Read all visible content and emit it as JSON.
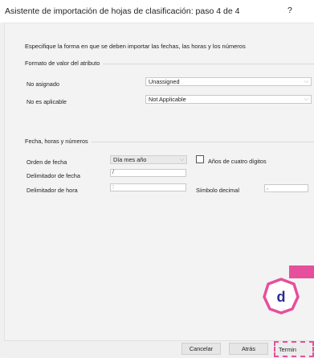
{
  "window": {
    "title": "Asistente de importación de hojas de clasificación: paso 4 de 4",
    "help": "?"
  },
  "instruction": "Especifique la forma en que se deben importar las fechas, las horas y los números",
  "attribute_format": {
    "section_title": "Formato de valor del atributo",
    "rows": [
      {
        "label": "No asignado",
        "value": "Unassigned"
      },
      {
        "label": "No es aplicable",
        "value": "Not Applicable"
      }
    ]
  },
  "datetime": {
    "section_title": "Fecha, horas y números",
    "date_order_label": "Orden de fecha",
    "date_order_value": "Día mes año",
    "four_digit_years_label": "Años de cuatro dígitos",
    "date_delimiter_label": "Delimitador de fecha",
    "date_delimiter_value": "/",
    "time_delimiter_label": "Delimitador de hora",
    "time_delimiter_value": ":",
    "decimal_symbol_label": "Símbolo decimal",
    "decimal_symbol_value": ","
  },
  "buttons": {
    "cancel": "Cancelar",
    "back": "Atrás",
    "finish": "Termin"
  },
  "annotation": {
    "marker_letter": "d",
    "accent_color": "#e64f9c"
  }
}
